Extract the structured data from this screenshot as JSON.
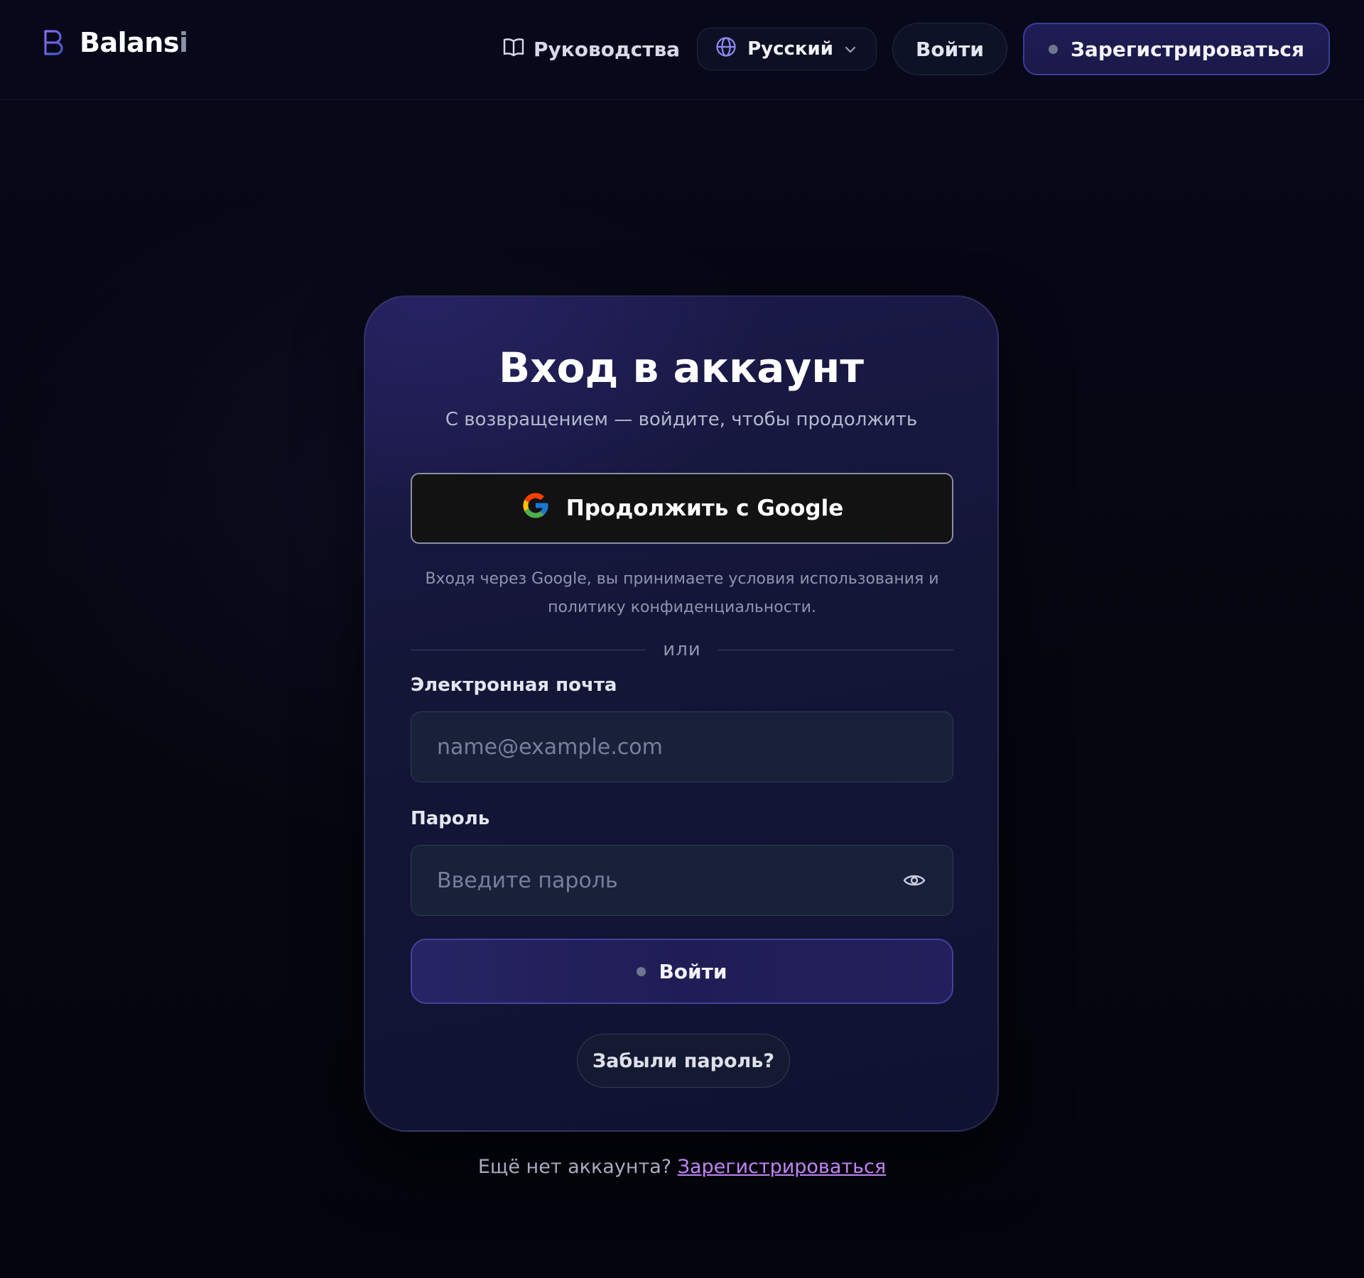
{
  "header": {
    "brand": {
      "letter": "B",
      "name_main": "Balans",
      "name_tail": "i"
    },
    "nav": {
      "guides_label": "Руководства",
      "language_selected": "Русский",
      "login_label": "Войти",
      "signup_label": "Зарегистрироваться"
    }
  },
  "card": {
    "title": "Вход в аккаунт",
    "subtitle": "С возвращением — войдите, чтобы продолжить",
    "google_button_label": "Продолжить с Google",
    "google_note": "Входя через Google, вы принимаете условия использования и политику конфиденциальности.",
    "divider_text": "или",
    "email": {
      "label": "Электронная почта",
      "placeholder": "name@example.com",
      "value": ""
    },
    "password": {
      "label": "Пароль",
      "placeholder": "Введите пароль",
      "value": ""
    },
    "submit_label": "Войти",
    "forgot_label": "Забыли пароль?"
  },
  "footer": {
    "prompt": "Ещё нет аккаунта?",
    "signup_link": "Зарегистрироваться"
  },
  "colors": {
    "background": "#05060f",
    "card": "#151638",
    "accent": "#45419f",
    "link": "#c084f5"
  },
  "icons": {
    "logo": "b-logo-icon",
    "guides": "book-icon",
    "language": "globe-icon",
    "dropdown": "chevron-down-icon",
    "google": "google-icon",
    "password_toggle": "eye-icon"
  }
}
